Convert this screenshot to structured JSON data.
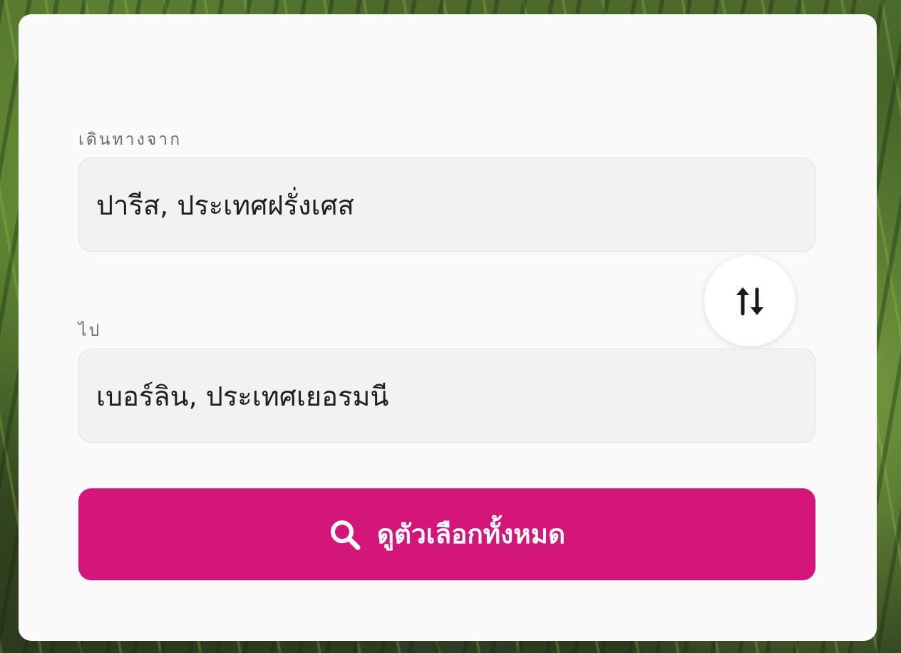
{
  "form": {
    "origin_label": "เดินทางจาก",
    "origin_value": "ปารีส, ประเทศฝรั่งเศส",
    "destination_label": "ไป",
    "destination_value": "เบอร์ลิน, ประเทศเยอรมนี",
    "swap_icon": "swap-vertical-arrows-icon",
    "search_icon": "search-icon",
    "search_label": "ดูตัวเลือกทั้งหมด"
  },
  "colors": {
    "accent": "#d4157a",
    "card_background": "#fafafa",
    "input_background": "#f2f2f2",
    "label_text": "#6b6b6b"
  }
}
